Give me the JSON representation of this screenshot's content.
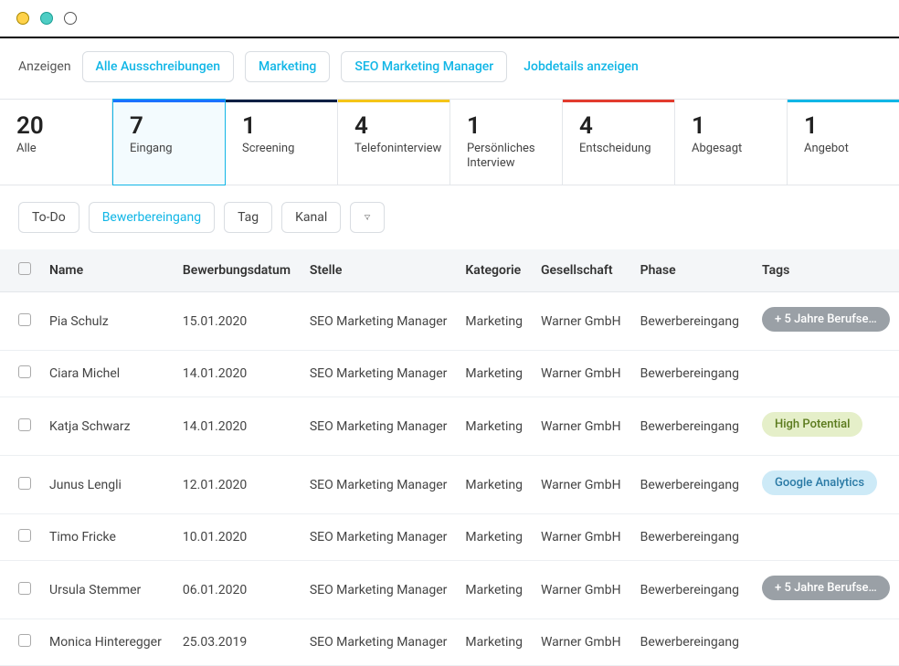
{
  "breadcrumb": {
    "label": "Anzeigen",
    "items": [
      "Alle Ausschreibungen",
      "Marketing",
      "SEO Marketing Manager"
    ],
    "action": "Jobdetails anzeigen"
  },
  "stages": [
    {
      "count": "20",
      "label": "Alle",
      "bar": "",
      "active": false
    },
    {
      "count": "7",
      "label": "Eingang",
      "bar": "#1a72ff",
      "active": true
    },
    {
      "count": "1",
      "label": "Screening",
      "bar": "#0a1f44",
      "active": false
    },
    {
      "count": "4",
      "label": "Telefoninterview",
      "bar": "#f5c518",
      "active": false
    },
    {
      "count": "1",
      "label": "Persönliches Interview",
      "bar": "",
      "active": false
    },
    {
      "count": "4",
      "label": "Entscheidung",
      "bar": "#e23b2e",
      "active": false
    },
    {
      "count": "1",
      "label": "Abgesagt",
      "bar": "",
      "active": false
    },
    {
      "count": "1",
      "label": "Angebot",
      "bar": "#11b6e6",
      "active": false
    }
  ],
  "filters": {
    "items": [
      {
        "label": "To-Do",
        "active": false
      },
      {
        "label": "Bewerbereingang",
        "active": true
      },
      {
        "label": "Tag",
        "active": false
      },
      {
        "label": "Kanal",
        "active": false
      }
    ]
  },
  "table": {
    "headers": {
      "name": "Name",
      "date": "Bewerbungsdatum",
      "stelle": "Stelle",
      "kategorie": "Kategorie",
      "gesellschaft": "Gesellschaft",
      "phase": "Phase",
      "tags": "Tags"
    },
    "rows": [
      {
        "name": "Pia Schulz",
        "date": "15.01.2020",
        "stelle": "SEO Marketing Manager",
        "kategorie": "Marketing",
        "gesellschaft": "Warner GmbH",
        "phase": "Bewerbereingang",
        "tag": {
          "text": "+ 5 Jahre Berufser…",
          "cls": "tag-grey"
        }
      },
      {
        "name": "Ciara Michel",
        "date": "14.01.2020",
        "stelle": "SEO Marketing Manager",
        "kategorie": "Marketing",
        "gesellschaft": "Warner GmbH",
        "phase": "Bewerbereingang",
        "tag": null
      },
      {
        "name": "Katja Schwarz",
        "date": "14.01.2020",
        "stelle": "SEO Marketing Manager",
        "kategorie": "Marketing",
        "gesellschaft": "Warner GmbH",
        "phase": "Bewerbereingang",
        "tag": {
          "text": "High Potential",
          "cls": "tag-green"
        }
      },
      {
        "name": "Junus Lengli",
        "date": "12.01.2020",
        "stelle": "SEO Marketing Manager",
        "kategorie": "Marketing",
        "gesellschaft": "Warner GmbH",
        "phase": "Bewerbereingang",
        "tag": {
          "text": "Google Analytics",
          "cls": "tag-blue"
        }
      },
      {
        "name": "Timo Fricke",
        "date": "10.01.2020",
        "stelle": "SEO Marketing Manager",
        "kategorie": "Marketing",
        "gesellschaft": "Warner GmbH",
        "phase": "Bewerbereingang",
        "tag": null
      },
      {
        "name": "Ursula Stemmer",
        "date": "06.01.2020",
        "stelle": "SEO Marketing Manager",
        "kategorie": "Marketing",
        "gesellschaft": "Warner GmbH",
        "phase": "Bewerbereingang",
        "tag": {
          "text": "+ 5 Jahre Berufser…",
          "cls": "tag-grey"
        }
      },
      {
        "name": "Monica Hinteregger",
        "date": "25.03.2019",
        "stelle": "SEO Marketing Manager",
        "kategorie": "Marketing",
        "gesellschaft": "Warner GmbH",
        "phase": "Bewerbereingang",
        "tag": null
      }
    ]
  }
}
